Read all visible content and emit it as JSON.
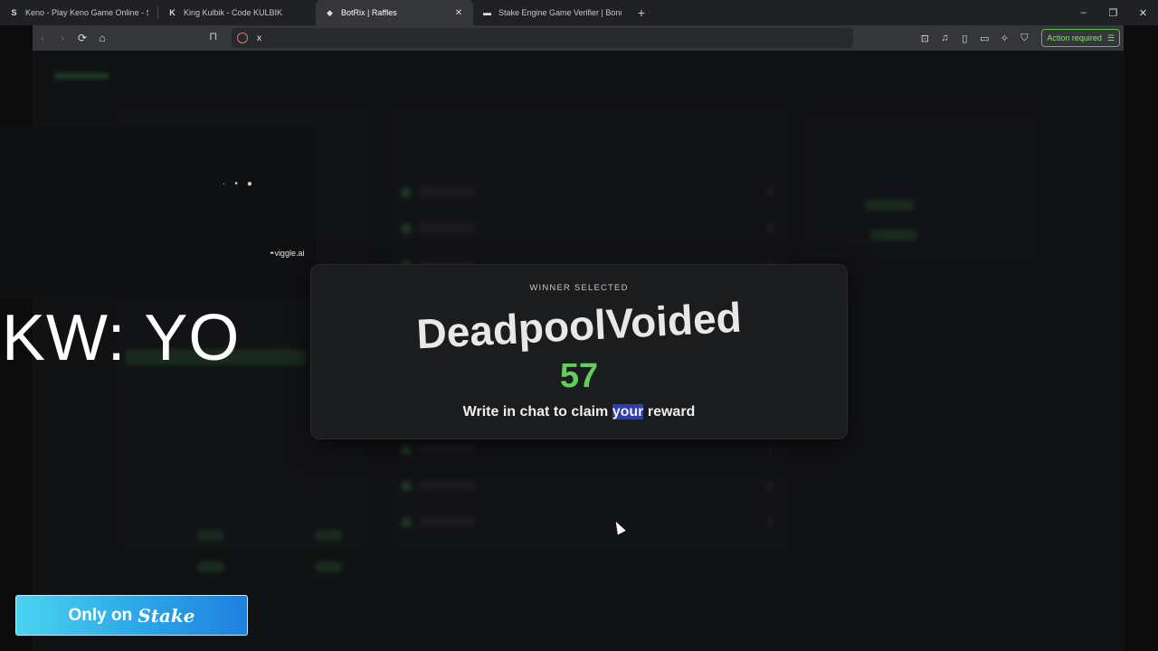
{
  "browser": {
    "tabs": [
      {
        "title": "Keno - Play Keno Game Online - Stak",
        "favicon": "S",
        "active": false
      },
      {
        "title": "King Kulbik - Code KULBIK",
        "favicon": "K",
        "active": false
      },
      {
        "title": "BotRix | Raffles",
        "favicon": "◆",
        "active": true
      },
      {
        "title": "Stake Engine Game Verifier | BonusH",
        "favicon": "▬",
        "active": false
      }
    ],
    "new_tab_label": "+",
    "url": "x",
    "action_required_label": "Action required",
    "window_controls": {
      "minimize": "–",
      "restore": "❐",
      "close": "✕"
    }
  },
  "overlay": {
    "viggle_label": "viggle.ai",
    "keyword_text": "KW: YO"
  },
  "modal": {
    "label": "WINNER SELECTED",
    "winner_name": "DeadpoolVoided",
    "winner_number": "57",
    "claim_before": "Write in chat to claim ",
    "claim_highlight": "your",
    "claim_after": " reward"
  },
  "banner": {
    "prefix": "Only on",
    "brand": "Stake"
  },
  "colors": {
    "accent_green": "#5fcf58",
    "highlight_blue": "#2d3fae",
    "banner_blue": "#2aa6e8"
  }
}
